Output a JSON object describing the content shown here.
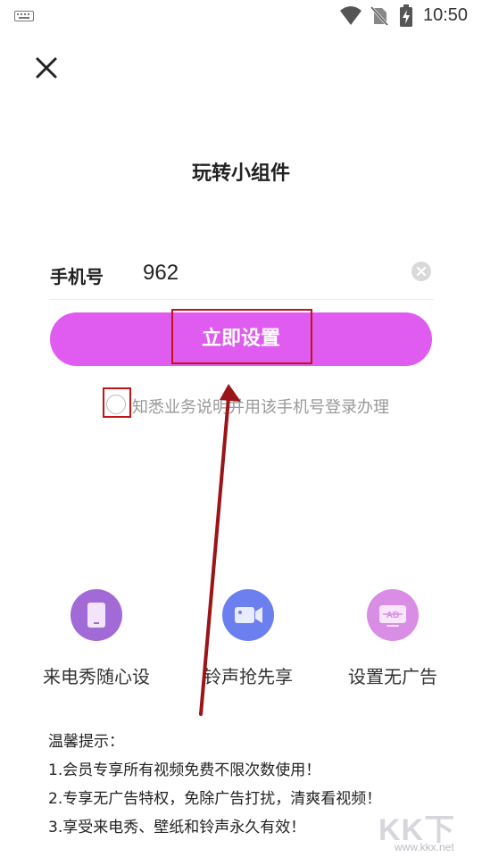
{
  "status_bar": {
    "time": "10:50",
    "icons": [
      "keyboard-icon",
      "wifi-icon",
      "no-sim-icon",
      "battery-charging-icon"
    ]
  },
  "header": {
    "close_icon": "close-icon",
    "title": "玩转小组件"
  },
  "form": {
    "phone_label": "手机号",
    "phone_value": "962",
    "clear_icon": "clear-icon",
    "submit_label": "立即设置",
    "agree_text": "知悉业务说明并用该手机号登录办理"
  },
  "features": [
    {
      "label": "来电秀随心设",
      "icon": "phone-screen-icon",
      "color": "#a26ad6"
    },
    {
      "label": "铃声抢先享",
      "icon": "video-camera-icon",
      "color": "#6c7fef"
    },
    {
      "label": "设置无广告",
      "icon": "no-ad-icon",
      "color": "#d98de4"
    }
  ],
  "tips": {
    "title": "温馨提示：",
    "lines": [
      "1.会员专享所有视频免费不限次数使用！",
      "2.专享无广告特权，免除广告打扰，清爽看视频！",
      "3.享受来电秀、壁纸和铃声永久有效！"
    ]
  },
  "colors": {
    "accent": "#e05cf0",
    "annotation": "#c0141a"
  },
  "watermark": {
    "logo": "KK下载",
    "url": "www.kkx.net"
  }
}
